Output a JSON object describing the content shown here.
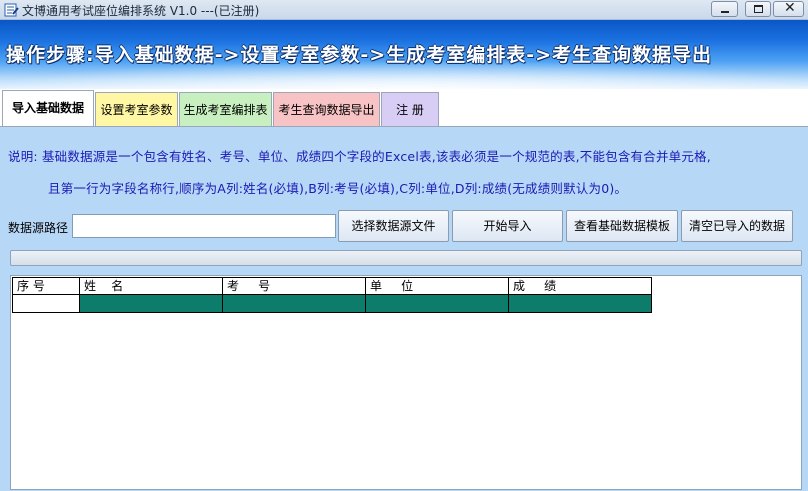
{
  "window": {
    "title": "文博通用考试座位编排系统 V1.0 ---(已注册)",
    "icon": "app-icon"
  },
  "banner": {
    "text": "操作步骤:导入基础数据->设置考室参数->生成考室编排表->考生查询数据导出"
  },
  "tabs": [
    {
      "label": "导入基础数据",
      "active": true
    },
    {
      "label": "设置考室参数",
      "active": false
    },
    {
      "label": "生成考室编排表",
      "active": false
    },
    {
      "label": "考生查询数据导出",
      "active": false
    },
    {
      "label": "注 册",
      "active": false
    }
  ],
  "import_page": {
    "note_line1": "说明: 基础数据源是一个包含有姓名、考号、单位、成绩四个字段的Excel表,该表必须是一个规范的表,不能包含有合并单元格,",
    "note_line2": "且第一行为字段名称行,顺序为A列:姓名(必填),B列:考号(必填),C列:单位,D列:成绩(无成绩则默认为0)。",
    "path_label": "数据源路径",
    "path_value": "",
    "buttons": {
      "select_file": "选择数据源文件",
      "start_import": "开始导入",
      "view_template": "查看基础数据模板",
      "clear_data": "清空已导入的数据"
    },
    "progress": 0.0,
    "grid": {
      "columns": [
        "序 号",
        "姓    名",
        "考     号",
        "单     位",
        "成     绩"
      ],
      "rows": [
        [
          "",
          "",
          "",
          "",
          ""
        ]
      ]
    }
  },
  "colors": {
    "banner_top": "#0a56c7",
    "panel_bg": "#b7d7f7",
    "note_text": "#1a1ab4",
    "grid_selection": "#0e7c6b",
    "tab_2": "#fff7a3",
    "tab_3": "#c7efc0",
    "tab_4": "#f8c3c5",
    "tab_5": "#d8cdf5"
  }
}
